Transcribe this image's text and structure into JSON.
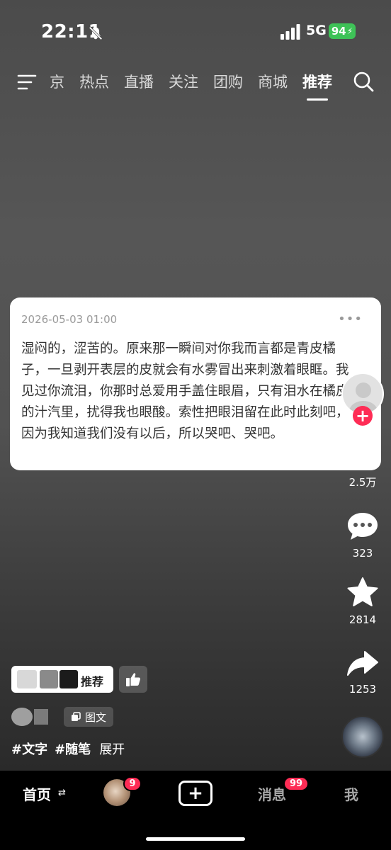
{
  "status_bar": {
    "time": "22:11",
    "network": "5G",
    "battery": "94"
  },
  "top_nav": {
    "tabs": [
      "京",
      "热点",
      "直播",
      "关注",
      "团购",
      "商城",
      "推荐"
    ],
    "active_tab": "推荐"
  },
  "post": {
    "date": "2026-05-03 01:00",
    "more": "•••",
    "text": "湿闷的，涩苦的。原来那一瞬间对你我而言都是青皮橘子，一旦剥开表层的皮就会有水雾冒出来刺激着眼眶。我见过你流泪，你那时总爱用手盖住眼眉，只有泪水在橘皮的汁汽里，扰得我也眼酸。索性把眼泪留在此时此刻吧，因为我知道我们没有以后，所以哭吧、哭吧。"
  },
  "sidebar": {
    "likes": "2.5万",
    "comments": "323",
    "favorites": "2814",
    "shares": "1253"
  },
  "author": {
    "recommend_label": "推荐",
    "type_label": "图文"
  },
  "tags": [
    "#文字",
    "#随笔"
  ],
  "expand_label": "展开",
  "tab_bar": {
    "home": "首页",
    "friends_badge": "9",
    "messages": "消息",
    "messages_badge": "99",
    "me": "我"
  },
  "colors": {
    "accent": "#fe2c55",
    "battery": "#3ec257"
  }
}
